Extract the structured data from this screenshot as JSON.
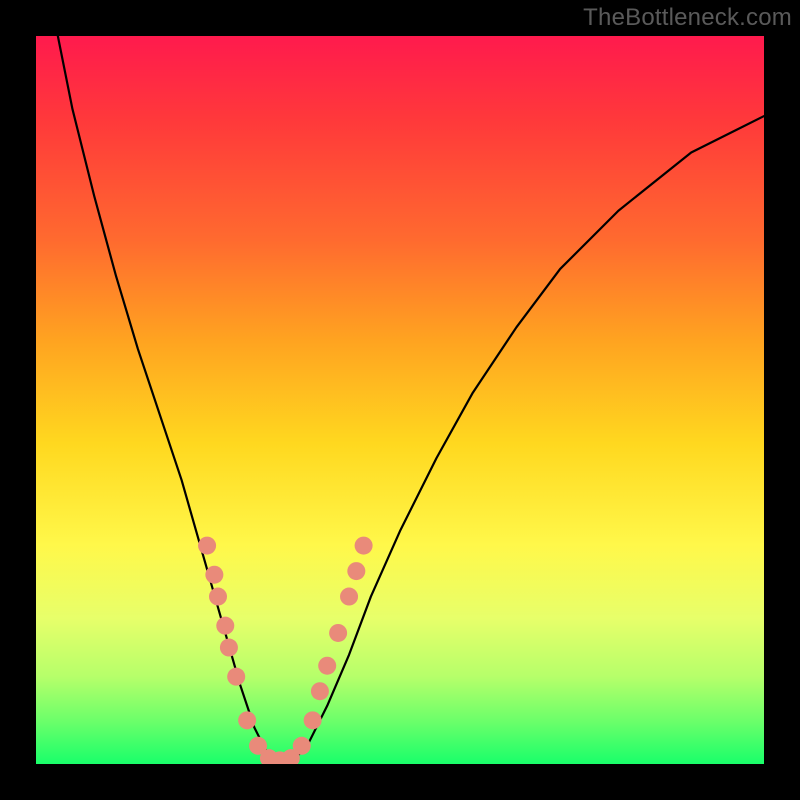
{
  "watermark": "TheBottleneck.com",
  "colors": {
    "curve_stroke": "#000000",
    "marker_fill": "#e98a7a",
    "marker_stroke": "#e98a7a"
  },
  "chart_data": {
    "type": "line",
    "title": "",
    "xlabel": "",
    "ylabel": "",
    "xlim": [
      0,
      100
    ],
    "ylim": [
      0,
      100
    ],
    "series": [
      {
        "name": "bottleneck-curve",
        "x": [
          3,
          5,
          8,
          11,
          14,
          17,
          20,
          22,
          24,
          26,
          28,
          30,
          31.5,
          33,
          35,
          37,
          40,
          43,
          46,
          50,
          55,
          60,
          66,
          72,
          80,
          90,
          100
        ],
        "y": [
          100,
          90,
          78,
          67,
          57,
          48,
          39,
          32,
          25,
          18,
          11,
          5,
          2,
          0.5,
          0.5,
          2,
          8,
          15,
          23,
          32,
          42,
          51,
          60,
          68,
          76,
          84,
          89
        ]
      }
    ],
    "markers": [
      {
        "x": 23.5,
        "y": 30
      },
      {
        "x": 24.5,
        "y": 26
      },
      {
        "x": 25.0,
        "y": 23
      },
      {
        "x": 26.0,
        "y": 19
      },
      {
        "x": 26.5,
        "y": 16
      },
      {
        "x": 27.5,
        "y": 12
      },
      {
        "x": 29.0,
        "y": 6
      },
      {
        "x": 30.5,
        "y": 2.5
      },
      {
        "x": 32.0,
        "y": 0.8
      },
      {
        "x": 33.5,
        "y": 0.5
      },
      {
        "x": 35.0,
        "y": 0.8
      },
      {
        "x": 36.5,
        "y": 2.5
      },
      {
        "x": 38.0,
        "y": 6
      },
      {
        "x": 39.0,
        "y": 10
      },
      {
        "x": 40.0,
        "y": 13.5
      },
      {
        "x": 41.5,
        "y": 18
      },
      {
        "x": 43.0,
        "y": 23
      },
      {
        "x": 44.0,
        "y": 26.5
      },
      {
        "x": 45.0,
        "y": 30
      }
    ]
  }
}
